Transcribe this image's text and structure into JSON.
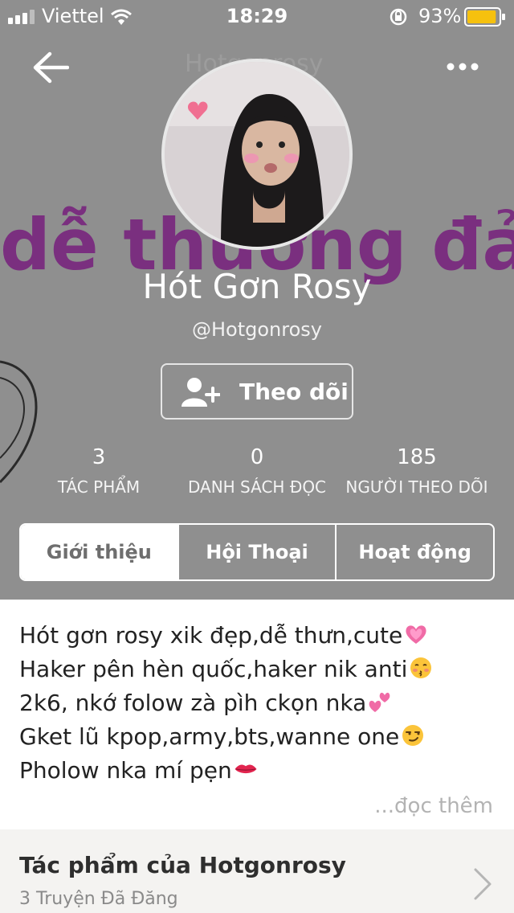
{
  "status_bar": {
    "carrier": "Viettel",
    "time": "18:29",
    "battery": "93%",
    "battery_level": 0.93
  },
  "nav": {
    "title": "Hotgonrosy"
  },
  "profile": {
    "display_name": "Hót Gơn Rosy",
    "handle": "@Hotgonrosy",
    "follow_label": "Theo dõi"
  },
  "stats": [
    {
      "value": "3",
      "label": "TÁC PHẨM"
    },
    {
      "value": "0",
      "label": "DANH SÁCH ĐỌC"
    },
    {
      "value": "185",
      "label": "NGƯỜI THEO DÕI"
    }
  ],
  "tabs": [
    {
      "label": "Giới thiệu"
    },
    {
      "label": "Hội Thoại"
    },
    {
      "label": "Hoạt động"
    }
  ],
  "bio": {
    "lines": [
      "Hót gơn rosy xik đẹp,dễ thưn,cute",
      "Haker pên hèn quốc,haker nik anti",
      "2k6, nkớ folow zà pìh ckọn nka",
      "Gket lũ kpop,army,bts,wanne one",
      "Pholow nka mí pẹn"
    ],
    "read_more": "...đọc thêm"
  },
  "works": {
    "title": "Tác phẩm của Hotgonrosy",
    "subtitle": "3 Truyện Đã Đăng"
  },
  "cover_text": "dễ thương đảm đ",
  "colors": {
    "header_bg": "#8f8f8f",
    "active_tab_text": "#6e6e6e",
    "battery_yellow": "#f6c10e",
    "cover_text_purple": "#7a2f7f"
  }
}
